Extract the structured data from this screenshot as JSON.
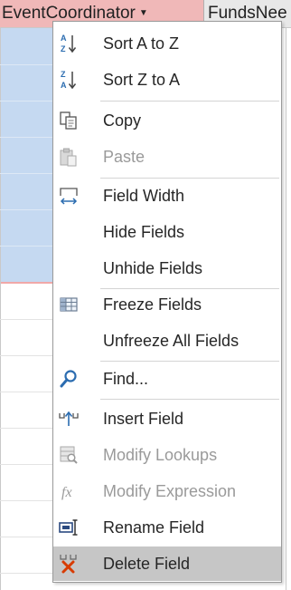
{
  "header": {
    "column1_label": "EventCoordinator",
    "column2_label": "FundsNee"
  },
  "menu": {
    "items": [
      {
        "label": "Sort A to Z",
        "icon": "sort-ascending-icon",
        "enabled": true
      },
      {
        "label": "Sort Z to A",
        "icon": "sort-descending-icon",
        "enabled": true
      },
      {
        "label": "Copy",
        "icon": "copy-icon",
        "enabled": true
      },
      {
        "label": "Paste",
        "icon": "paste-icon",
        "enabled": false
      },
      {
        "label": "Field Width",
        "icon": "field-width-icon",
        "enabled": true
      },
      {
        "label": "Hide Fields",
        "icon": "",
        "enabled": true
      },
      {
        "label": "Unhide Fields",
        "icon": "",
        "enabled": true
      },
      {
        "label": "Freeze Fields",
        "icon": "freeze-grid-icon",
        "enabled": true
      },
      {
        "label": "Unfreeze All Fields",
        "icon": "",
        "enabled": true
      },
      {
        "label": "Find...",
        "icon": "find-icon",
        "enabled": true
      },
      {
        "label": "Insert Field",
        "icon": "insert-field-icon",
        "enabled": true
      },
      {
        "label": "Modify Lookups",
        "icon": "modify-lookups-icon",
        "enabled": false
      },
      {
        "label": "Modify Expression",
        "icon": "fx-icon",
        "enabled": false
      },
      {
        "label": "Rename Field",
        "icon": "rename-field-icon",
        "enabled": true
      },
      {
        "label": "Delete Field",
        "icon": "delete-field-icon",
        "enabled": true,
        "highlighted": true
      }
    ]
  },
  "colors": {
    "selected_column": "#c5d9f1",
    "header_selected": "#f0b8b8",
    "menu_highlight": "#c6c6c6",
    "delete_red": "#d83b01",
    "icon_blue": "#2b6cb0"
  }
}
